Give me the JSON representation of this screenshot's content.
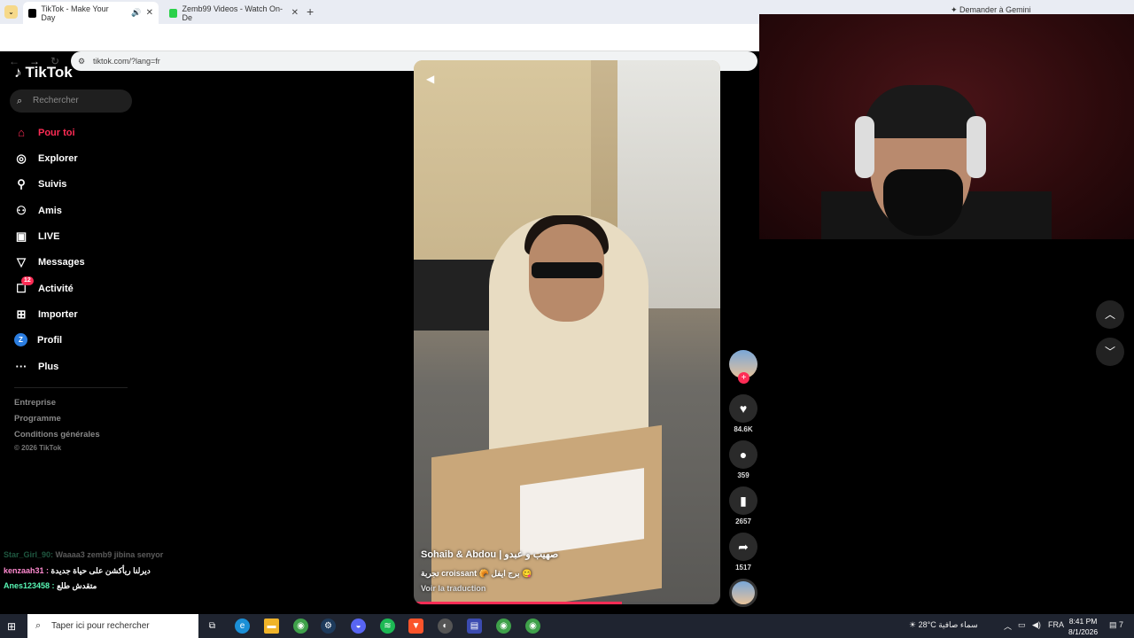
{
  "browser": {
    "tabs": [
      {
        "label": "TikTok - Make Your Day"
      },
      {
        "label": "Zemb99 Videos - Watch On-De"
      }
    ],
    "gemini_label": "Demander à Gemini",
    "url": "tiktok.com/?lang=fr"
  },
  "tiktok": {
    "logo": "TikTok",
    "search_placeholder": "Rechercher",
    "nav": [
      {
        "label": "Pour toi",
        "icon": "home-icon"
      },
      {
        "label": "Explorer",
        "icon": "compass-icon"
      },
      {
        "label": "Suivis",
        "icon": "user-follow-icon"
      },
      {
        "label": "Amis",
        "icon": "friends-icon"
      },
      {
        "label": "LIVE",
        "icon": "live-icon"
      },
      {
        "label": "Messages",
        "icon": "messages-icon"
      },
      {
        "label": "Activité",
        "icon": "activity-icon",
        "badge": "12"
      },
      {
        "label": "Importer",
        "icon": "upload-icon"
      },
      {
        "label": "Profil",
        "icon": "avatar",
        "avatar_letter": "Z"
      },
      {
        "label": "Plus",
        "icon": "more-icon"
      }
    ],
    "footer": {
      "company": "Entreprise",
      "program": "Programme",
      "terms": "Conditions générales",
      "copyright": "© 2026 TikTok"
    },
    "video": {
      "title": "Sohaib & Abdou | صهيب و عبدو",
      "description": "تجربة croissant 🥐 برج ايفل 😋",
      "translate": "Voir la traduction",
      "progress": 0.68
    },
    "actions": {
      "likes": "84.6K",
      "comments": "359",
      "saves": "2657",
      "shares": "1517"
    }
  },
  "chat": [
    {
      "user": "Star_Girl_90:",
      "message": "Waaaa3 zemb9 jibina senyor",
      "faded": true
    },
    {
      "user": "kenzaah31 :",
      "message": "ديرلنا ريأكشن على حياة جديدة",
      "faded": false
    },
    {
      "user": "Anes123458 :",
      "message": "متقدش طلع",
      "faded": false
    }
  ],
  "taskbar": {
    "search_placeholder": "Taper ici pour rechercher",
    "weather": "28°C سماء صافية",
    "lang": "FRA",
    "time": "8:41 PM",
    "date": "8/1/2026",
    "notification_count": "7"
  }
}
